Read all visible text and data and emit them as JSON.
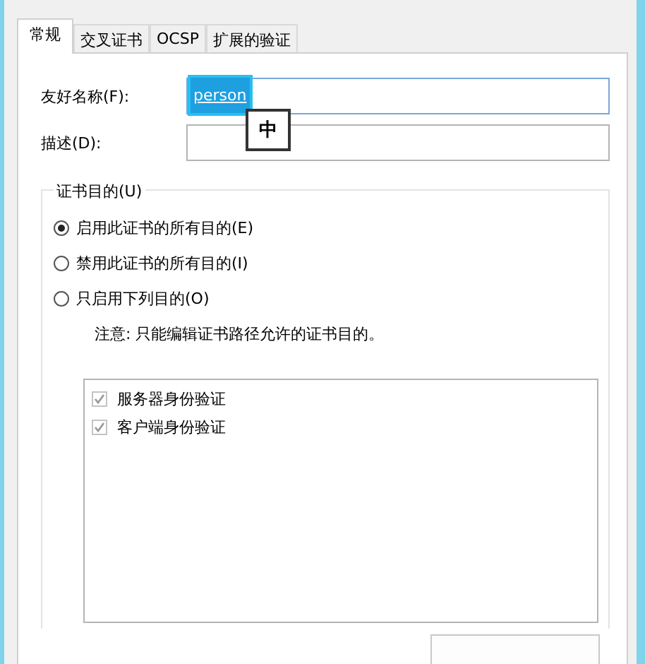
{
  "tabs": [
    {
      "label": "常规",
      "selected": true
    },
    {
      "label": "交叉证书",
      "selected": false
    },
    {
      "label": "OCSP",
      "selected": false
    },
    {
      "label": "扩展的验证",
      "selected": false
    }
  ],
  "fields": [
    {
      "label": "友好名称(F):",
      "value": "person",
      "composing": true
    },
    {
      "label": "描述(D):",
      "composing": false
    }
  ],
  "ime_indicator": "中",
  "purpose_group": {
    "title": "证书目的(U)",
    "options": [
      {
        "label": "启用此证书的所有目的(E)",
        "selected": true
      },
      {
        "label": "禁用此证书的所有目的(I)",
        "selected": false
      },
      {
        "label": "只启用下列目的(O)",
        "selected": false
      }
    ],
    "note": "注意: 只能编辑证书路径允许的证书目的。",
    "purposes": [
      {
        "label": "服务器身份验证",
        "checked": true,
        "disabled": true
      },
      {
        "label": "客户端身份验证",
        "checked": true,
        "disabled": true
      }
    ]
  }
}
